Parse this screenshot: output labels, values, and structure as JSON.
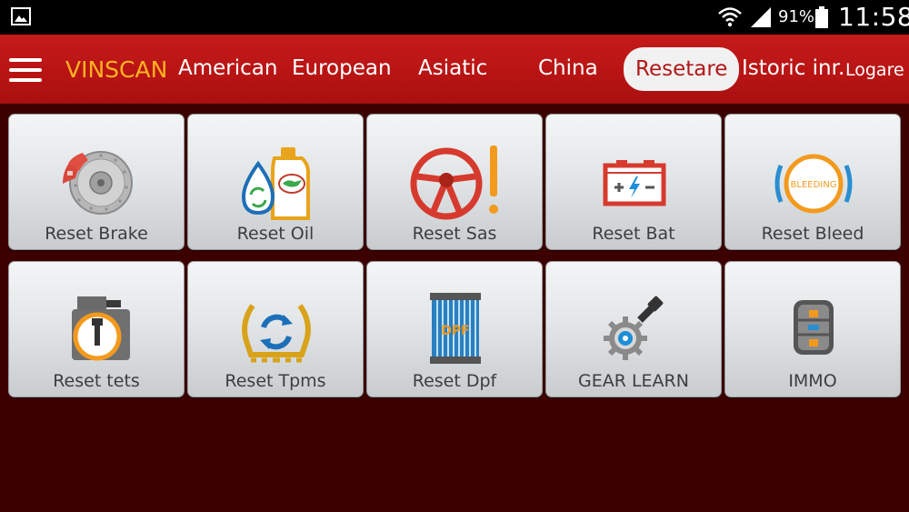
{
  "status_bar": {
    "battery_percent": "91%",
    "time": "11:58",
    "icons": [
      "gallery-icon",
      "wifi-icon",
      "signal-icon",
      "battery-icon"
    ]
  },
  "nav": {
    "brand": "VINSCAN",
    "items": [
      "American",
      "European",
      "Asiatic",
      "China",
      "Resetare",
      "Istoric inr.."
    ],
    "active": "Resetare",
    "login": "Logare"
  },
  "tiles": [
    {
      "label": "Reset Brake",
      "icon": "brake-disc-icon"
    },
    {
      "label": "Reset Oil",
      "icon": "oil-can-icon"
    },
    {
      "label": "Reset Sas",
      "icon": "steering-wheel-icon"
    },
    {
      "label": "Reset Bat",
      "icon": "battery-icon"
    },
    {
      "label": "Reset Bleed",
      "icon": "bleeding-icon",
      "icon_text": "BLEEDING"
    },
    {
      "label": "Reset tets",
      "icon": "throttle-body-icon"
    },
    {
      "label": "Reset Tpms",
      "icon": "tpms-icon"
    },
    {
      "label": "Reset Dpf",
      "icon": "dpf-filter-icon",
      "icon_text": "DPF"
    },
    {
      "label": "GEAR LEARN",
      "icon": "gear-learn-icon"
    },
    {
      "label": "IMMO",
      "icon": "immobilizer-icon"
    }
  ],
  "colors": {
    "navbar": "#c41a1a",
    "brand": "#ffb321",
    "background": "#3c0000",
    "accent_orange": "#f39a1e"
  }
}
